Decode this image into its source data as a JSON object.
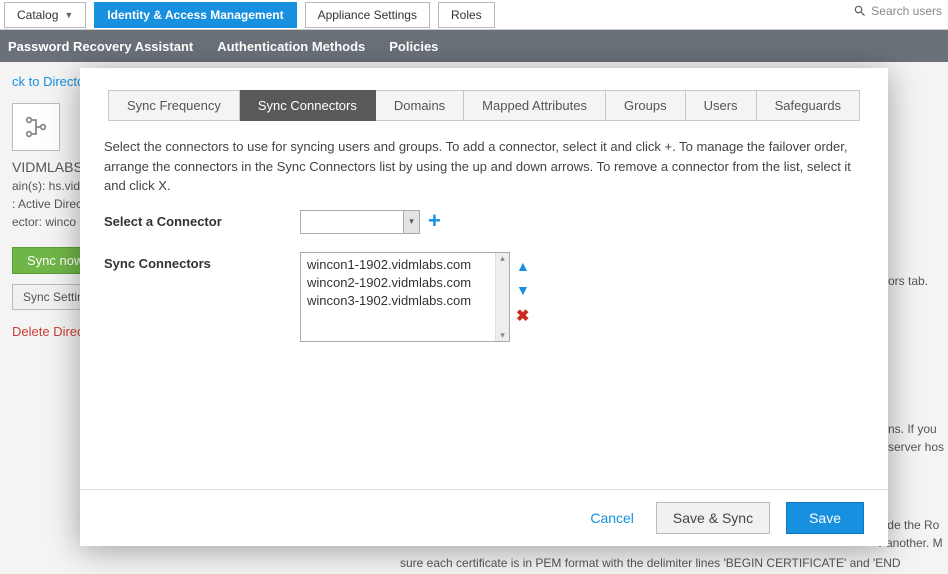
{
  "topTabs": {
    "catalog": "Catalog",
    "iam": "Identity & Access Management",
    "appliance": "Appliance Settings",
    "roles": "Roles"
  },
  "search": {
    "placeholder": "Search users"
  },
  "subNav": {
    "pra": "Password Recovery Assistant",
    "auth": "Authentication Methods",
    "policies": "Policies"
  },
  "bg": {
    "back": "ck to Directori",
    "dirTitle": "VIDMLABS",
    "line1": "ain(s): hs.vid",
    "line2": ": Active Direc",
    "line3": "ector: winco",
    "syncNow": "Sync now",
    "syncSettings": "Sync Settings",
    "deleteDir": "Delete Directo",
    "rightTab": "ctors tab.",
    "rightA": "ains. If you ",
    "rightB": "y server hos",
    "rightC": "vide the Ro",
    "rightD": "r another. M",
    "bot": "sure each certificate is in PEM format with the delimiter lines 'BEGIN CERTIFICATE' and 'END"
  },
  "modal": {
    "tabs": {
      "freq": "Sync Frequency",
      "conn": "Sync Connectors",
      "domains": "Domains",
      "mapped": "Mapped Attributes",
      "groups": "Groups",
      "users": "Users",
      "safeguards": "Safeguards"
    },
    "desc": "Select the connectors to use for syncing users and groups. To add a connector, select it and click +. To manage the failover order, arrange the connectors in the Sync Connectors list by using the up and down arrows. To remove a connector from the list, select it and click X.",
    "selectLabel": "Select a Connector",
    "listLabel": "Sync Connectors",
    "items": [
      "wincon1-1902.vidmlabs.com",
      "wincon2-1902.vidmlabs.com",
      "wincon3-1902.vidmlabs.com"
    ],
    "buttons": {
      "cancel": "Cancel",
      "saveSync": "Save & Sync",
      "save": "Save"
    }
  }
}
